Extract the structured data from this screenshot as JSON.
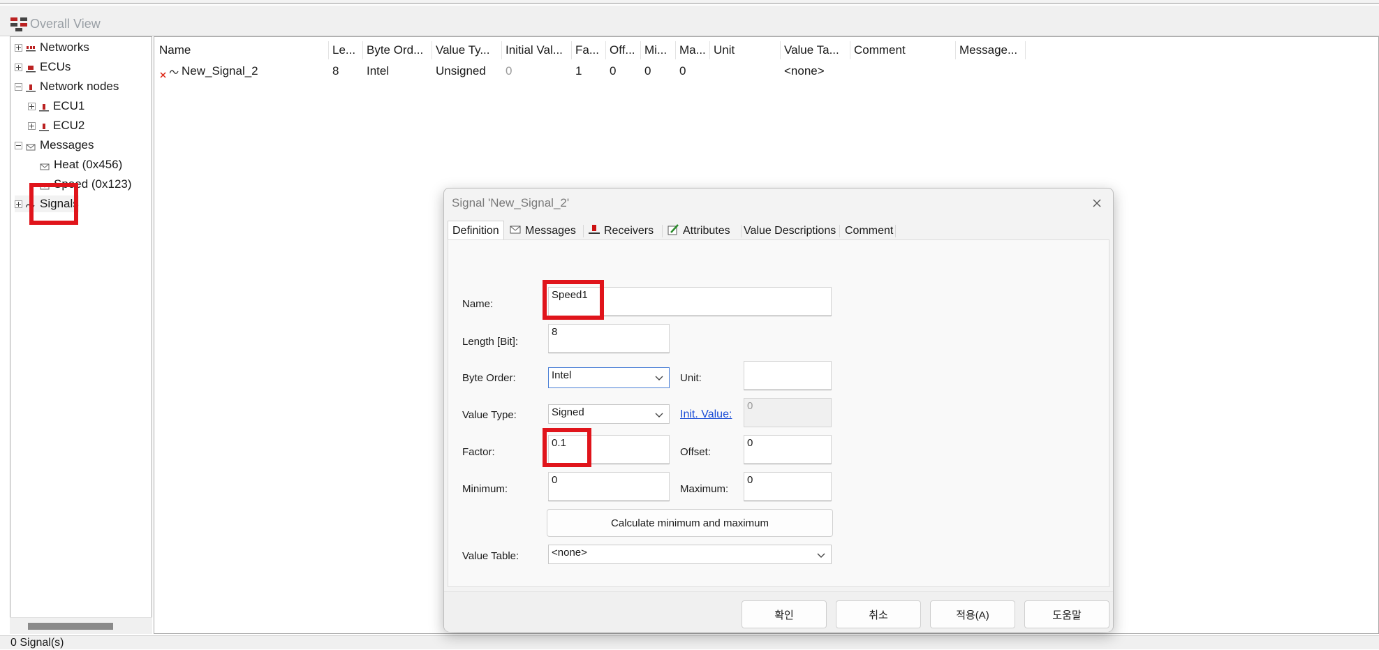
{
  "window": {
    "title": "Overall View"
  },
  "tree": {
    "items": [
      {
        "label": "Networks"
      },
      {
        "label": "ECUs"
      },
      {
        "label": "Network nodes"
      },
      {
        "label": "ECU1"
      },
      {
        "label": "ECU2"
      },
      {
        "label": "Messages"
      },
      {
        "label": "Heat (0x456)"
      },
      {
        "label": "Speed (0x123)"
      },
      {
        "label": "Signals"
      }
    ]
  },
  "list": {
    "columns": [
      "Name",
      "Le...",
      "Byte Ord...",
      "Value Ty...",
      "Initial Val...",
      "Fa...",
      "Off...",
      "Mi...",
      "Ma...",
      "Unit",
      "Value Ta...",
      "Comment",
      "Message..."
    ],
    "rows": [
      {
        "name": "New_Signal_2",
        "length": "8",
        "byte_order": "Intel",
        "value_type": "Unsigned",
        "initial_value": "0",
        "factor": "1",
        "offset": "0",
        "minimum": "0",
        "maximum": "0",
        "unit": "",
        "value_table": "<none>",
        "comment": "",
        "message": ""
      }
    ]
  },
  "status": {
    "text": "0 Signal(s)"
  },
  "dialog": {
    "title": "Signal 'New_Signal_2'",
    "tabs": [
      "Definition",
      "Messages",
      "Receivers",
      "Attributes",
      "Value Descriptions",
      "Comment"
    ],
    "fields": {
      "name_label": "Name:",
      "name_value": "Speed1",
      "length_label": "Length [Bit]:",
      "length_value": "8",
      "byte_order_label": "Byte Order:",
      "byte_order_value": "Intel",
      "unit_label": "Unit:",
      "unit_value": "",
      "value_type_label": "Value Type:",
      "value_type_value": "Signed",
      "init_value_label": "Init. Value:",
      "init_value_value": "0",
      "factor_label": "Factor:",
      "factor_value": "0.1",
      "offset_label": "Offset:",
      "offset_value": "0",
      "minimum_label": "Minimum:",
      "minimum_value": "0",
      "maximum_label": "Maximum:",
      "maximum_value": "0",
      "calc_button": "Calculate minimum and maximum",
      "value_table_label": "Value Table:",
      "value_table_value": "<none>"
    },
    "buttons": {
      "ok": "확인",
      "cancel": "취소",
      "apply": "적용(A)",
      "help": "도움말"
    }
  },
  "colors": {
    "highlight": "#e0141b",
    "link": "#1a4dd6",
    "accent": "#4a7fd6"
  }
}
